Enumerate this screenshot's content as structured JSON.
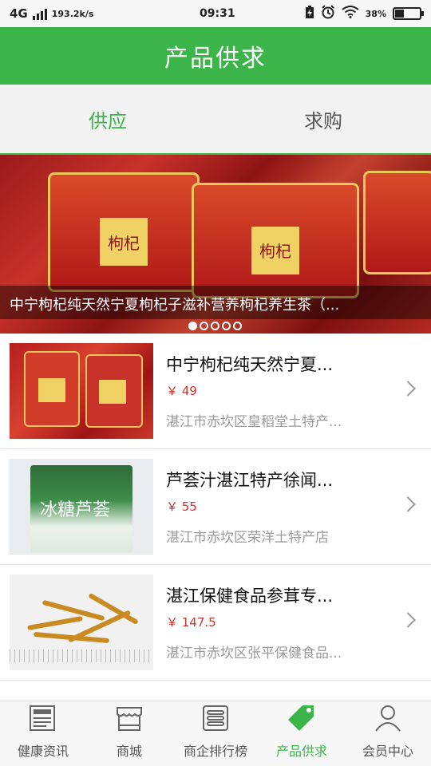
{
  "status_bar": {
    "network": "4G",
    "speed": "193.2k/s",
    "time": "09:31",
    "battery_pct": "38",
    "battery_level": 0.38
  },
  "header": {
    "title": "产品供求"
  },
  "tabs": [
    {
      "label": "供应",
      "active": true
    },
    {
      "label": "求购",
      "active": false
    }
  ],
  "banner": {
    "caption": "中宁枸杞纯天然宁夏枸杞子滋补营养枸杞养生茶（...",
    "slide_count": 5,
    "current_slide": 1
  },
  "products": [
    {
      "name": "中宁枸杞纯天然宁夏...",
      "price": "￥ 49",
      "shop": "湛江市赤坎区皇稻堂土特产..."
    },
    {
      "name": "芦荟汁湛江特产徐闻...",
      "price": "￥ 55",
      "shop": "湛江市赤坎区荣洋土特产店"
    },
    {
      "name": "湛江保健食品参茸专...",
      "price": "￥ 147.5",
      "shop": "湛江市赤坎区张平保健食品..."
    }
  ],
  "bottom_nav": [
    {
      "label": "健康资讯",
      "icon": "newspaper-icon",
      "active": false
    },
    {
      "label": "商城",
      "icon": "storefront-icon",
      "active": false
    },
    {
      "label": "商企排行榜",
      "icon": "ranking-list-icon",
      "active": false
    },
    {
      "label": "产品供求",
      "icon": "tag-icon",
      "active": true
    },
    {
      "label": "会员中心",
      "icon": "user-icon",
      "active": false
    }
  ],
  "colors": {
    "accent": "#3bb54a",
    "price": "#d0312d"
  }
}
